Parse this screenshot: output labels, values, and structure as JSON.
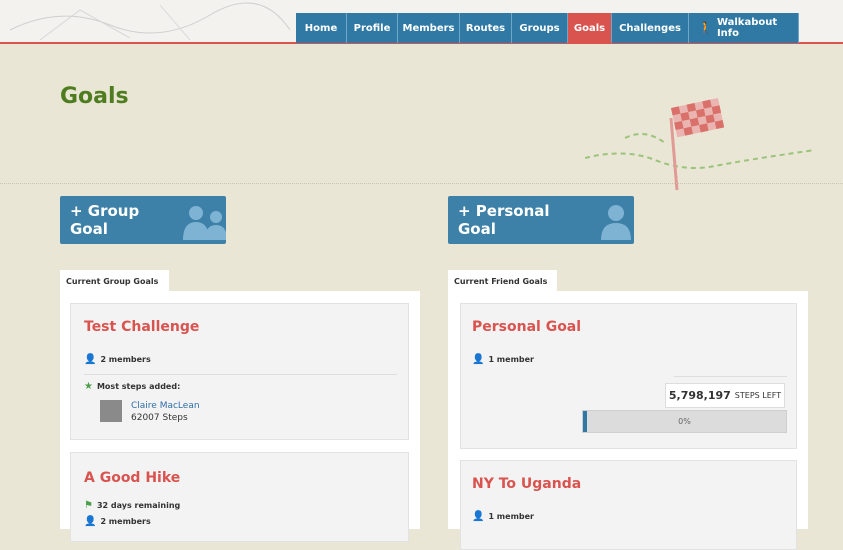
{
  "nav": {
    "items": [
      {
        "label": "Home",
        "active": false
      },
      {
        "label": "Profile",
        "active": false
      },
      {
        "label": "Members",
        "active": false
      },
      {
        "label": "Routes",
        "active": false
      },
      {
        "label": "Groups",
        "active": false
      },
      {
        "label": "Goals",
        "active": true
      },
      {
        "label": "Challenges",
        "active": false
      },
      {
        "label": "Walkabout Info",
        "active": false,
        "icon": "walking-person-icon"
      }
    ]
  },
  "page": {
    "title": "Goals"
  },
  "buttons": {
    "group_goal": "+ Group Goal",
    "personal_goal": "+ Personal Goal"
  },
  "group_section": {
    "tab": "Current Group Goals",
    "cards": [
      {
        "title": "Test Challenge",
        "members": "2 members",
        "highlight_label": "Most steps added:",
        "leader_name": "Claire MacLean",
        "leader_steps": "62007 Steps"
      },
      {
        "title": "A Good Hike",
        "days_remaining": "32 days remaining",
        "members": "2 members"
      }
    ]
  },
  "friend_section": {
    "tab": "Current Friend Goals",
    "cards": [
      {
        "title": "Personal Goal",
        "members": "1 member",
        "steps_left_value": "5,798,197",
        "steps_left_unit": "STEPS LEFT",
        "progress_label": "0%",
        "progress": 0
      },
      {
        "title": "NY To Uganda",
        "members": "1 member"
      }
    ]
  },
  "colors": {
    "nav_bg": "#2f79a4",
    "nav_active": "#d9534f",
    "title_green": "#4e7c1e",
    "card_title_red": "#d9534f",
    "button_blue": "#3d80a8"
  }
}
